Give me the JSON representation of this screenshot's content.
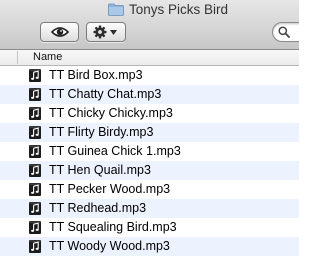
{
  "window": {
    "title": "Tonys Picks Bird",
    "title_icon": "folder-icon"
  },
  "toolbar": {
    "quicklook_icon": "eye-icon",
    "action_icon": "gear-icon",
    "action_menu_icon": "caret-down-icon",
    "search_icon": "magnifier-icon"
  },
  "list": {
    "column_header": "Name",
    "row_alt_color": "#edf3fe",
    "file_icon": "audio-file-icon",
    "files": [
      "TT Bird Box.mp3",
      "TT Chatty Chat.mp3",
      "TT Chicky Chicky.mp3",
      "TT Flirty Birdy.mp3",
      "TT Guinea Chick 1.mp3",
      "TT Hen Quail.mp3",
      "TT Pecker Wood.mp3",
      "TT Redhead.mp3",
      "TT Squealing Bird.mp3",
      "TT Woody Wood.mp3"
    ]
  }
}
